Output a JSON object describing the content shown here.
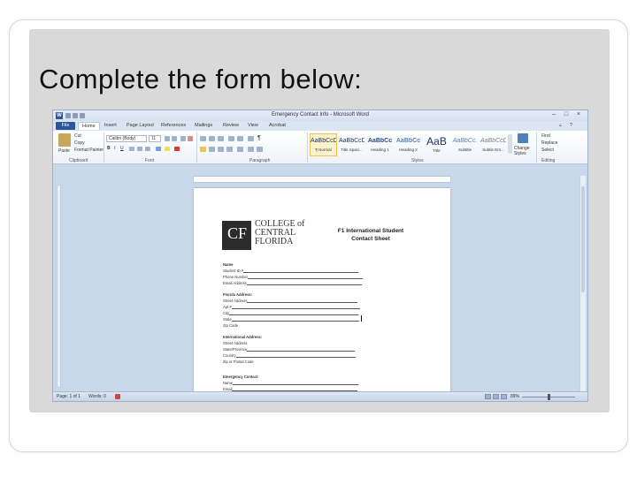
{
  "slide": {
    "title": "Complete the form below:"
  },
  "word": {
    "window_title": "Emergency Contact Info - Microsoft Word",
    "tabs": [
      "File",
      "Home",
      "Insert",
      "Page Layout",
      "References",
      "Mailings",
      "Review",
      "View",
      "Acrobat"
    ],
    "active_tab": "Home",
    "clipboard": {
      "paste": "Paste",
      "cut": "Cut",
      "copy": "Copy",
      "format_painter": "Format Painter",
      "label": "Clipboard"
    },
    "font": {
      "name": "Calibri (Body)",
      "size": "11",
      "label": "Font"
    },
    "paragraph": {
      "label": "Paragraph"
    },
    "styles": {
      "label": "Styles",
      "items": [
        {
          "sample": "AaBbCcDc",
          "name": "¶ Normal"
        },
        {
          "sample": "AaBbCcDc",
          "name": "Title Spaci..."
        },
        {
          "sample": "AaBbCc",
          "name": "Heading 1"
        },
        {
          "sample": "AaBbCc",
          "name": "Heading 2"
        },
        {
          "sample": "AaB",
          "name": "Title"
        },
        {
          "sample": "AaBbCc.",
          "name": "Subtitle"
        },
        {
          "sample": "AaBbCcDc",
          "name": "Subtle Em..."
        }
      ],
      "change_styles": "Change Styles"
    },
    "editing": {
      "find": "Find",
      "replace": "Replace",
      "select": "Select",
      "label": "Editing"
    },
    "document": {
      "logo_lines": [
        "COLLEGE of",
        "CENTRAL",
        "FLORIDA"
      ],
      "logo_mark": "CF",
      "title_line1": "F1 International Student",
      "title_line2": "Contact Sheet",
      "fields": {
        "name": "Name",
        "student_id": "Student ID #",
        "phone": "Phone Number",
        "email": "Email Address",
        "florida_address": "Florida Address:",
        "street": "Street Address",
        "apt": "Apt #",
        "city": "City",
        "state": "State",
        "zip": "Zip Code",
        "intl_address": "International Address:",
        "intl_street": "Street Address",
        "intl_state": "State/Province",
        "country": "Country",
        "postal": "Zip or Postal Code",
        "emergency": "Emergency Contact:",
        "em_name": "Name",
        "em_email": "Email"
      }
    },
    "status": {
      "page": "Page: 1 of 1",
      "words": "Words: 0",
      "zoom": "89%"
    }
  }
}
